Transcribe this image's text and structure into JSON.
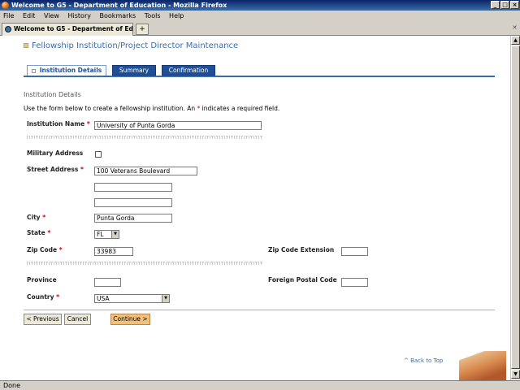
{
  "window": {
    "title": "Welcome to G5 - Department of Education - Mozilla Firefox",
    "controls": [
      "_",
      "□",
      "×"
    ]
  },
  "menu": [
    "File",
    "Edit",
    "View",
    "History",
    "Bookmarks",
    "Tools",
    "Help"
  ],
  "browser_tab": {
    "label": "Welcome to G5 - Department of Edu...",
    "new_tab": "+"
  },
  "page": {
    "title": "Fellowship Institution/Project Director Maintenance",
    "tabs": [
      "Institution Details",
      "Summary",
      "Confirmation"
    ],
    "section_heading": "Institution Details",
    "instructions_pre": "Use the form below to create a fellowship institution. An ",
    "required_marker": "*",
    "instructions_post": " indicates a required field."
  },
  "fields": {
    "institution_name": {
      "label": "Institution Name",
      "value": "University of Punta Gorda"
    },
    "military_address": {
      "label": "Military Address",
      "checked": false
    },
    "street_address": {
      "label": "Street Address",
      "line1": "100 Veterans Boulevard",
      "line2": "",
      "line3": ""
    },
    "city": {
      "label": "City",
      "value": "Punta Gorda"
    },
    "state": {
      "label": "State",
      "value": "FL"
    },
    "zip": {
      "label": "Zip Code",
      "value": "33983"
    },
    "zip_ext": {
      "label": "Zip Code Extension",
      "value": ""
    },
    "province": {
      "label": "Province",
      "value": ""
    },
    "foreign_postal": {
      "label": "Foreign Postal Code",
      "value": ""
    },
    "country": {
      "label": "Country",
      "value": "USA"
    }
  },
  "buttons": {
    "previous": "< Previous",
    "cancel": "Cancel",
    "continue": "Continue >"
  },
  "back_to_top": "^ Back to Top",
  "status": "Done"
}
